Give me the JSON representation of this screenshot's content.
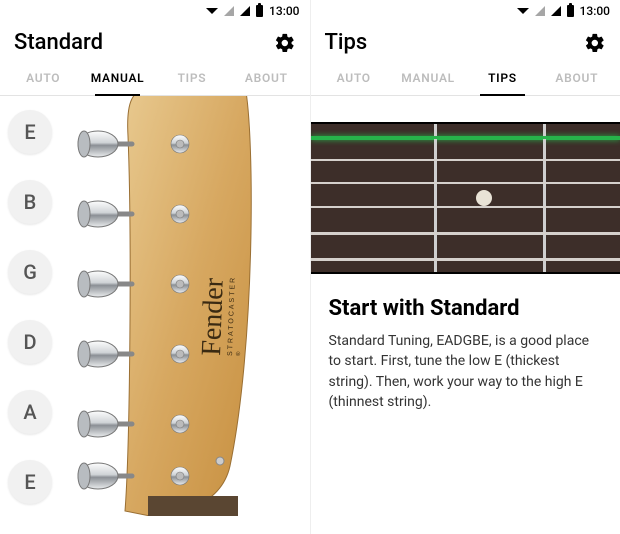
{
  "status": {
    "time": "13:00"
  },
  "left": {
    "title": "Standard",
    "tabs": {
      "auto": "AUTO",
      "manual": "MANUAL",
      "tips": "TIPS",
      "about": "ABOUT"
    },
    "strings": {
      "s0": "E",
      "s1": "B",
      "s2": "G",
      "s3": "D",
      "s4": "A",
      "s5": "E"
    },
    "headstock": {
      "brand": "Fender",
      "model": "STRATOCASTER"
    }
  },
  "right": {
    "title": "Tips",
    "tabs": {
      "auto": "AUTO",
      "manual": "MANUAL",
      "tips": "TIPS",
      "about": "ABOUT"
    },
    "tip": {
      "title": "Start with Standard",
      "body": "Standard Tuning, EADGBE, is a good place to start. First, tune the low E (thickest string). Then, work your way to the high E (thinnest string)."
    }
  }
}
